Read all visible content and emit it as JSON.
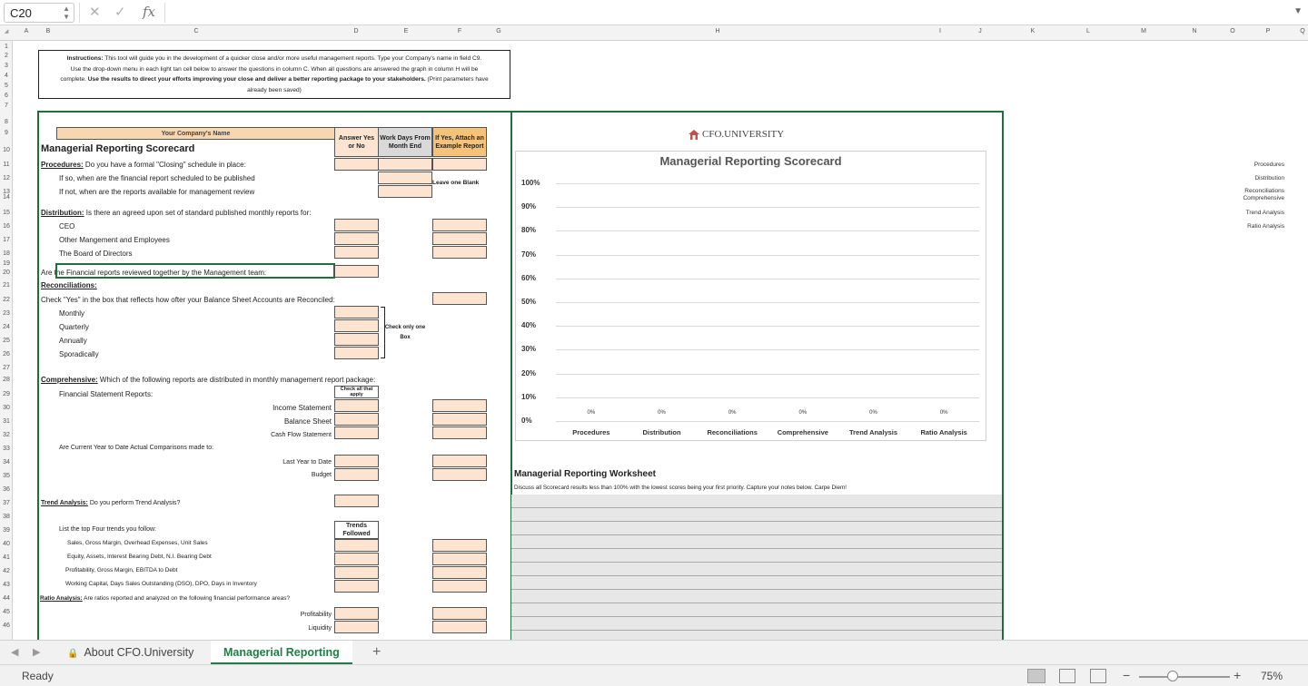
{
  "formula_bar": {
    "cell_ref": "C20",
    "cancel_icon": "✕",
    "enter_icon": "✓",
    "fx_label": "fx",
    "formula": ""
  },
  "columns": [
    "A",
    "B",
    "C",
    "D",
    "E",
    "F",
    "G",
    "H",
    "I",
    "J",
    "K",
    "L",
    "M",
    "N",
    "O",
    "P",
    "Q"
  ],
  "rows": [
    "1",
    "2",
    "3",
    "4",
    "5",
    "6",
    "7",
    "8",
    "9",
    "10",
    "11",
    "12",
    "13",
    "14",
    "15",
    "16",
    "17",
    "18",
    "19",
    "20",
    "21",
    "22",
    "23",
    "24",
    "25",
    "26",
    "27",
    "28",
    "29",
    "30",
    "31",
    "32",
    "33",
    "34",
    "35",
    "36",
    "37",
    "38",
    "39",
    "40",
    "41",
    "42",
    "43",
    "44",
    "45",
    "46"
  ],
  "instructions": {
    "label": "Instructions:",
    "line1": " This tool will guide you in the development of a quicker close and/or more useful management reports.  Type your Company's name in field C9.",
    "line2": "Use the drop-down menu in each light tan cell below to answer the questions in column C.  When all questions are answered the graph in column H will be",
    "line3a": "complete.  ",
    "line3b": "Use the results to direct your efforts improving your close and deliver a better reporting package to your stakeholders.",
    "line3c": "  (Print parameters have",
    "line4": "already been saved)"
  },
  "form": {
    "company_name_label": "Your Company's Name",
    "col_answer": "Answer Yes or No",
    "col_workdays": "Work Days From Month End",
    "col_attach": "If Yes, Attach an Example Report",
    "title": "Managerial Reporting Scorecard",
    "procedures_head": "Procedures:",
    "procedures_q": " Do you have a formal \"Closing\" schedule in place:",
    "proc_if_so": "If so,  when are the financial report scheduled to be published",
    "proc_if_not": "If not,  when are the reports available for management review",
    "leave_blank": "Leave one Blank",
    "distribution_head": "Distribution:",
    "distribution_q": " Is there an agreed upon set of  standard published monthly reports  for:",
    "ceo": "CEO",
    "other_mgmt": "Other Mangement and Employees",
    "board": "The Board of Directors",
    "reviewed_q": "Are the Financial reports reviewed together by the Management team:",
    "reconciliations_head": "Reconciliations:",
    "recon_q": "Check \"Yes\"  in the box that reflects how ofter your Balance Sheet Accounts are Reconciled:",
    "monthly": "Monthly",
    "quarterly": "Quarterly",
    "annually": "Annually",
    "sporadically": "Sporadically",
    "check_one": "Check only one Box",
    "comprehensive_head": "Comprehensive:",
    "comprehensive_q": "  Which of the following reports are distributed  in monthly management report package:",
    "check_all": "Check all that apply",
    "fs_reports": "Financial Statement Reports:",
    "income": "Income Statement",
    "balance": "Balance Sheet",
    "cashflow": "Cash Flow Statement",
    "cy_q": "Are Current Year to Date  Actual Comparisons made  to:",
    "last_year": "Last Year to Date",
    "budget": "Budget",
    "trend_head": "Trend Analysis:",
    "trend_q": " Do you perform Trend Analysis?",
    "list_top": "List the top Four trends you follow:",
    "trends_followed": "Trends Followed",
    "trend1": "Sales, Gross Margin, Overhead Expenses, Unit Sales",
    "trend2": "Equity, Assets,  Interest Bearing Debt, N.I. Bearing Debt",
    "trend3": "Profitability, Gross Margin,  EBITDA to Debt",
    "trend4": "Working Capital, Days Sales Outstanding (DSO),  DPO,  Days in Inventory",
    "ratio_head": "Ratio Analysis:",
    "ratio_q": " Are ratios reported and analyzed on the following financial performance areas?",
    "profitability": "Profitability",
    "liquidity": "Liquidity"
  },
  "logo": {
    "text": "CFO.UNIVERSITY"
  },
  "chart_data": {
    "type": "bar",
    "title": "Managerial  Reporting Scorecard",
    "categories": [
      "Procedures",
      "Distribution",
      "Reconciliations",
      "Comprehensive",
      "Trend Analysis",
      "Ratio Analysis"
    ],
    "values": [
      0,
      0,
      0,
      0,
      0,
      0
    ],
    "data_labels": [
      "0%",
      "0%",
      "0%",
      "0%",
      "0%",
      "0%"
    ],
    "y_ticks": [
      "0%",
      "10%",
      "20%",
      "30%",
      "40%",
      "50%",
      "60%",
      "70%",
      "80%",
      "90%",
      "100%"
    ],
    "ylim": [
      0,
      100
    ],
    "grid": true
  },
  "side_labels": [
    "Procedures",
    "Distribution",
    "Reconciliations",
    "Comprehensive",
    "Trend Analysis",
    "Ratio Analysis"
  ],
  "worksheet": {
    "title": "Managerial Reporting Worksheet",
    "subtitle": "Discuss all Scorecard results less than 100% with the lowest scores being your first priority.  Capture your notes below.  Carpe Diem!"
  },
  "tabs": {
    "about": "About CFO.University",
    "active": "Managerial Reporting",
    "add": "+"
  },
  "status": {
    "ready": "Ready",
    "zoom": "75%",
    "minus": "−",
    "plus": "+"
  }
}
